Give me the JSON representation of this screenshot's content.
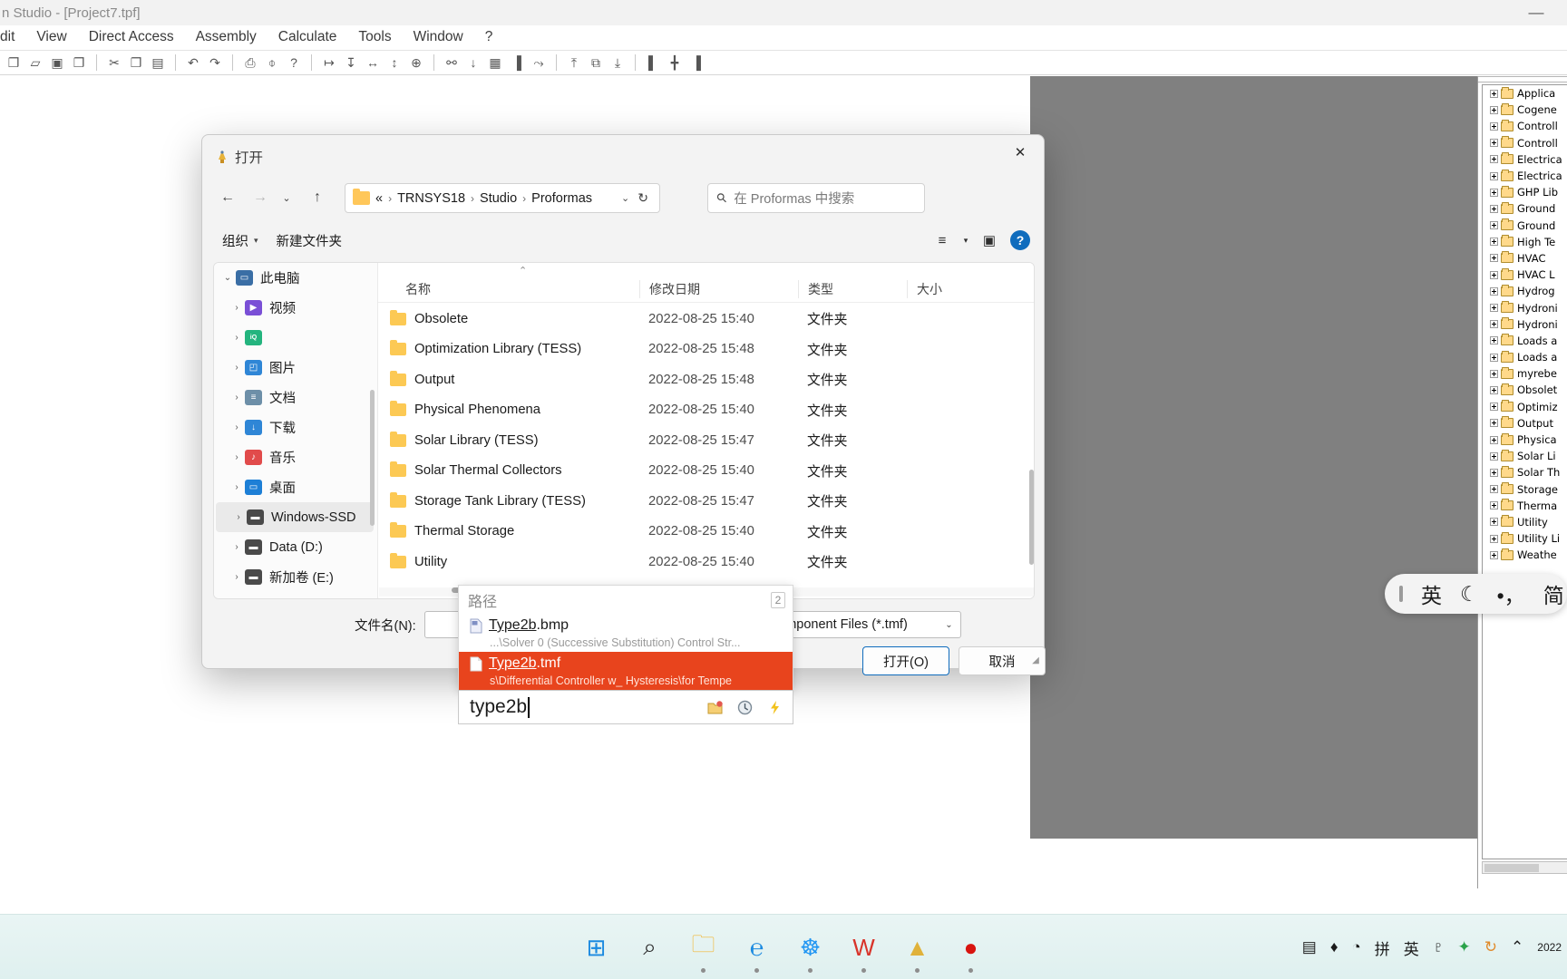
{
  "app": {
    "title": "n Studio - [Project7.tpf]",
    "minimize_label": "—",
    "menu": [
      "dit",
      "View",
      "Direct Access",
      "Assembly",
      "Calculate",
      "Tools",
      "Window",
      "?"
    ],
    "toolbar_icons": [
      "new-icon",
      "open-icon",
      "save-icon",
      "save-all-icon",
      "sep",
      "cut-icon",
      "copy-icon",
      "paste-icon",
      "sep",
      "undo-icon",
      "redo-icon",
      "sep",
      "print-icon",
      "print-preview-icon",
      "help-icon",
      "sep",
      "align-horizontal-icon",
      "align-vertical-icon",
      "distribute-h-icon",
      "distribute-v-icon",
      "center-icon",
      "sep",
      "link-icon",
      "down-icon",
      "table-icon",
      "paint-icon",
      "macro-icon",
      "sep",
      "align-top-icon",
      "align-middle-icon",
      "align-bottom-icon",
      "sep",
      "group-left-icon",
      "group-center-icon",
      "group-right-icon"
    ]
  },
  "tree_panel": {
    "items": [
      "Applica",
      "Cogene",
      "Controll",
      "Controll",
      "Electrica",
      "Electrica",
      "GHP Lib",
      "Ground",
      "Ground",
      "High Te",
      "HVAC",
      "HVAC L",
      "Hydrog",
      "Hydroni",
      "Hydroni",
      "Loads a",
      "Loads a",
      "myrebe",
      "Obsolet",
      "Optimiz",
      "Output",
      "Physica",
      "Solar Li",
      "Solar Th",
      "Storage",
      "Therma",
      "Utility",
      "Utility Li",
      "Weathe"
    ]
  },
  "ime_bar": {
    "mode": "英",
    "moon": "☾",
    "punct": "•，",
    "shape": "简"
  },
  "dialog": {
    "title": "打开",
    "close_label": "✕",
    "nav": {
      "back": "←",
      "forward": "→",
      "recent": "⌄",
      "up": "↑",
      "refresh": "↻",
      "address_chevron": "⌄"
    },
    "breadcrumbs": [
      "«",
      "TRNSYS18",
      "Studio",
      "Proformas"
    ],
    "breadcrumb_sep": "›",
    "search": {
      "icon": "search-icon",
      "placeholder": "在 Proformas 中搜索"
    },
    "commandbar": {
      "organize": "组织",
      "new_folder": "新建文件夹",
      "view_icon": "≡",
      "view_caret": "▾",
      "pane_icon": "▣",
      "help_icon": "?"
    },
    "nav_pane": {
      "items": [
        {
          "label": "此电脑",
          "caret": "⌄",
          "icon": "computer-icon",
          "color": "#3a6ea5",
          "glyph": "▭",
          "selected": false,
          "indent": 0
        },
        {
          "label": "视频",
          "caret": "›",
          "icon": "videos-icon",
          "color": "#7a4fd6",
          "glyph": "▶",
          "selected": false,
          "indent": 1
        },
        {
          "label": "",
          "caret": "›",
          "icon": "iqiyi-icon",
          "color": "#24b47e",
          "glyph": "iQ",
          "selected": false,
          "indent": 1
        },
        {
          "label": "图片",
          "caret": "›",
          "icon": "pictures-icon",
          "color": "#2f86d6",
          "glyph": "◰",
          "selected": false,
          "indent": 1
        },
        {
          "label": "文档",
          "caret": "›",
          "icon": "documents-icon",
          "color": "#6d8fa8",
          "glyph": "≡",
          "selected": false,
          "indent": 1
        },
        {
          "label": "下载",
          "caret": "›",
          "icon": "downloads-icon",
          "color": "#2f86d6",
          "glyph": "↓",
          "selected": false,
          "indent": 1
        },
        {
          "label": "音乐",
          "caret": "›",
          "icon": "music-icon",
          "color": "#e14b4b",
          "glyph": "♪",
          "selected": false,
          "indent": 1
        },
        {
          "label": "桌面",
          "caret": "›",
          "icon": "desktop-icon",
          "color": "#1d7fd6",
          "glyph": "▭",
          "selected": false,
          "indent": 1
        },
        {
          "label": "Windows-SSD",
          "caret": "›",
          "icon": "drive-icon",
          "color": "#4a4a4a",
          "glyph": "▬",
          "selected": true,
          "indent": 1
        },
        {
          "label": "Data (D:)",
          "caret": "›",
          "icon": "drive-icon",
          "color": "#4a4a4a",
          "glyph": "▬",
          "selected": false,
          "indent": 1
        },
        {
          "label": "新加卷 (E:)",
          "caret": "›",
          "icon": "drive-icon",
          "color": "#4a4a4a",
          "glyph": "▬",
          "selected": false,
          "indent": 1
        }
      ]
    },
    "file_list": {
      "columns": [
        "名称",
        "修改日期",
        "类型",
        "大小"
      ],
      "sort_arrow": "⌃",
      "rows": [
        {
          "name": "Obsolete",
          "date": "2022-08-25 15:40",
          "type": "文件夹",
          "size": ""
        },
        {
          "name": "Optimization Library (TESS)",
          "date": "2022-08-25 15:48",
          "type": "文件夹",
          "size": ""
        },
        {
          "name": "Output",
          "date": "2022-08-25 15:48",
          "type": "文件夹",
          "size": ""
        },
        {
          "name": "Physical Phenomena",
          "date": "2022-08-25 15:40",
          "type": "文件夹",
          "size": ""
        },
        {
          "name": "Solar Library (TESS)",
          "date": "2022-08-25 15:47",
          "type": "文件夹",
          "size": ""
        },
        {
          "name": "Solar Thermal Collectors",
          "date": "2022-08-25 15:40",
          "type": "文件夹",
          "size": ""
        },
        {
          "name": "Storage Tank Library (TESS)",
          "date": "2022-08-25 15:47",
          "type": "文件夹",
          "size": ""
        },
        {
          "name": "Thermal Storage",
          "date": "2022-08-25 15:40",
          "type": "文件夹",
          "size": ""
        },
        {
          "name": "Utility",
          "date": "2022-08-25 15:40",
          "type": "文件夹",
          "size": ""
        }
      ]
    },
    "filename": {
      "label": "文件名(N):",
      "value": "",
      "caret": "⌄"
    },
    "filetype": {
      "value": "Component Files (*.tmf)",
      "caret": "⌄"
    },
    "buttons": {
      "open": "打开(O)",
      "cancel": "取消"
    }
  },
  "autocomplete": {
    "header": "路径",
    "count": "2",
    "items": [
      {
        "match": "Type2b",
        "ext": ".bmp",
        "subtitle": "...\\Solver 0 (Successive Substitution) Control Str...",
        "icon": "bmp-file-icon",
        "selected": false
      },
      {
        "match": "Type2b",
        "ext": ".tmf",
        "subtitle": "s\\Differential Controller w_ Hysteresis\\for Tempe",
        "icon": "tmf-file-icon",
        "selected": true
      }
    ],
    "input_value": "type2b",
    "icons": [
      "open-folder-icon",
      "history-icon",
      "lightning-icon"
    ],
    "highlight_color": "#e8441d"
  },
  "taskbar": {
    "apps": [
      {
        "name": "start-icon",
        "glyph": "⊞",
        "color": "#1b8ae0",
        "active": false
      },
      {
        "name": "search-icon",
        "glyph": "⌕",
        "color": "#2b2b2b",
        "active": false
      },
      {
        "name": "file-explorer-icon",
        "glyph": "🗀",
        "color": "#f2b632",
        "active": true
      },
      {
        "name": "edge-icon",
        "glyph": "℮",
        "color": "#1b8ae0",
        "active": true
      },
      {
        "name": "cloud-icon",
        "glyph": "☸",
        "color": "#2196f3",
        "active": true
      },
      {
        "name": "wps-icon",
        "glyph": "W",
        "color": "#d8342a",
        "active": true
      },
      {
        "name": "trnsys-icon",
        "glyph": "▲",
        "color": "#e0b23a",
        "active": true
      },
      {
        "name": "recorder-icon",
        "glyph": "●",
        "color": "#d8140f",
        "active": true
      }
    ],
    "tray": [
      {
        "name": "chevron-up-icon",
        "glyph": "⌃"
      },
      {
        "name": "sync-icon",
        "glyph": "↻"
      },
      {
        "name": "shield-icon",
        "glyph": "✦"
      },
      {
        "name": "microphone-icon",
        "glyph": "♇"
      },
      {
        "name": "ime-lang-icon",
        "glyph": "英"
      },
      {
        "name": "ime-pinyin-icon",
        "glyph": "拼"
      },
      {
        "name": "wifi-icon",
        "glyph": "◔"
      },
      {
        "name": "volume-icon",
        "glyph": "♦"
      },
      {
        "name": "battery-icon",
        "glyph": "▤"
      }
    ],
    "clock": "2022"
  }
}
